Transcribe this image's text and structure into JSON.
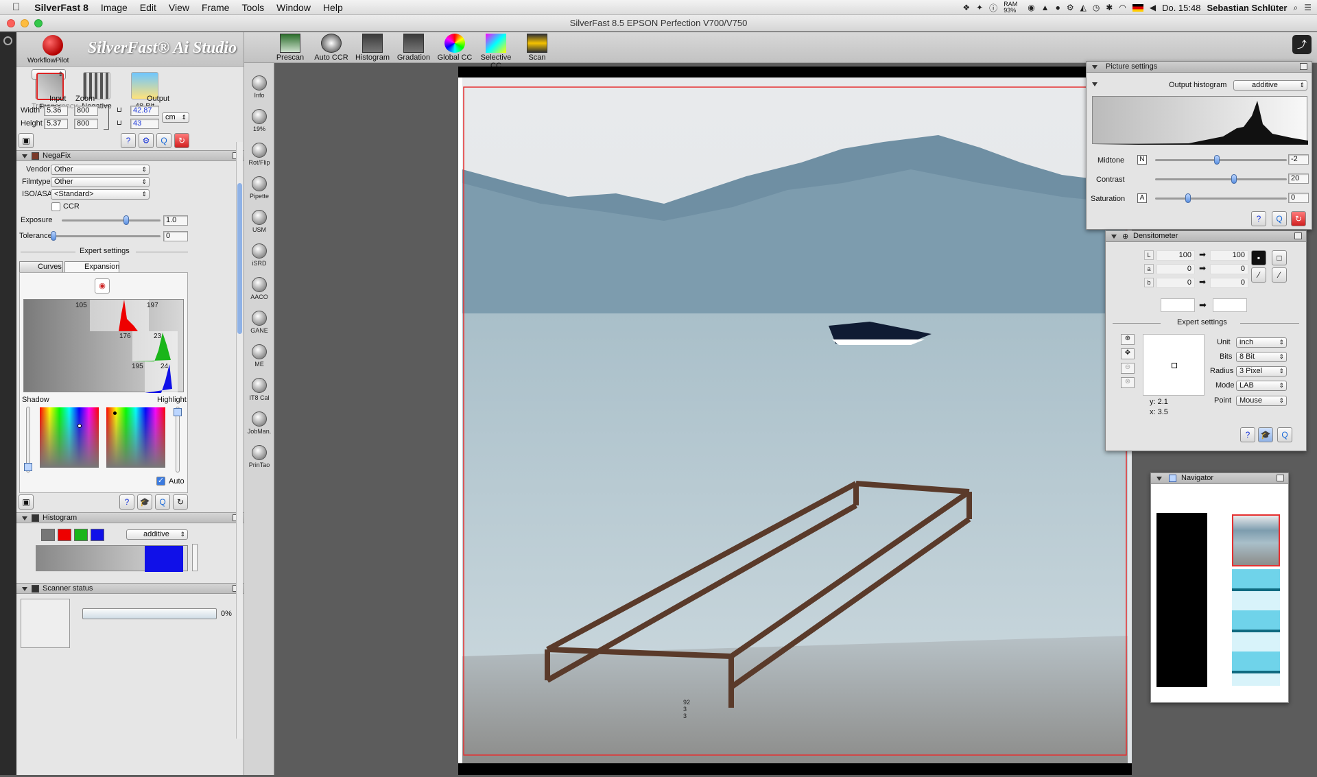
{
  "menubar": {
    "app": "SilverFast 8",
    "items": [
      "Image",
      "Edit",
      "View",
      "Frame",
      "Tools",
      "Window",
      "Help"
    ],
    "ram": "RAM 93%",
    "clock": "Do. 15:48",
    "user": "Sebastian Schlüter"
  },
  "window_title": "SilverFast 8.5 EPSON Perfection V700/V750",
  "logo": {
    "brand": "SilverFast® Ai Studio",
    "sub": "WorkflowPilot"
  },
  "modes": [
    {
      "label": "Transparency",
      "icon": "transparency-icon",
      "state": "dim"
    },
    {
      "label": "Negative",
      "icon": "negative-film-icon",
      "state": ""
    },
    {
      "label": "48 Bit",
      "icon": "48bit-palm-icon",
      "state": ""
    },
    {
      "label": "Frame",
      "icon": "frame-tools-icon",
      "state": "sel"
    }
  ],
  "dimensions": {
    "col_input": "Input",
    "col_zoom": "Zoom",
    "col_output": "Output",
    "width_label": "Width",
    "height_label": "Height",
    "width_in": "5.36",
    "width_zoom": "800",
    "width_out": "42.87",
    "height_in": "5.37",
    "height_zoom": "800",
    "height_out": "43",
    "unit": "cm"
  },
  "negafix": {
    "title": "NegaFix",
    "vendor_label": "Vendor",
    "vendor": "Other",
    "filmtype_label": "Filmtype",
    "filmtype": "Other",
    "iso_label": "ISO/ASA",
    "iso": "<Standard>",
    "ccr_label": "CCR",
    "exposure_label": "Exposure",
    "exposure": "1.0",
    "exposure_level": 0.65,
    "tolerance_label": "Tolerance",
    "tolerance": "0",
    "tolerance_level": 0.0,
    "expert": "Expert settings",
    "tab_curves": "Curves",
    "tab_expansion": "Expansion",
    "hist_red_left": "105",
    "hist_red_right": "197",
    "hist_green_left": "176",
    "hist_green_right": "23",
    "hist_blue_left": "195",
    "hist_blue_right": "24",
    "shadow": "Shadow",
    "highlight": "Highlight",
    "auto_label": "Auto"
  },
  "histogram": {
    "title": "Histogram",
    "mode": "additive"
  },
  "scanner_status": {
    "title": "Scanner status",
    "percent": "0%"
  },
  "toolbar": [
    {
      "label": "Prescan",
      "icon": "prescan-icon"
    },
    {
      "label": "Auto CCR",
      "icon": "auto-ccr-icon"
    },
    {
      "label": "Histogram",
      "icon": "histogram-icon"
    },
    {
      "label": "Gradation",
      "icon": "gradation-icon"
    },
    {
      "label": "Global CC",
      "icon": "global-cc-icon"
    },
    {
      "label": "Selective CC",
      "icon": "selective-cc-icon"
    },
    {
      "label": "Scan",
      "icon": "scan-icon"
    }
  ],
  "tools": [
    {
      "label": "Info",
      "icon": "info-icon"
    },
    {
      "label": "19%",
      "icon": "zoom-icon"
    },
    {
      "label": "Rot/Flip",
      "icon": "rotate-flip-icon"
    },
    {
      "label": "Pipette",
      "icon": "pipette-icon"
    },
    {
      "label": "USM",
      "icon": "usm-icon"
    },
    {
      "label": "iSRD",
      "icon": "isrd-icon"
    },
    {
      "label": "AACO",
      "icon": "aaco-icon"
    },
    {
      "label": "GANE",
      "icon": "gane-icon"
    },
    {
      "label": "ME",
      "icon": "me-icon"
    },
    {
      "label": "IT8 Cal",
      "icon": "it8-cal-icon"
    },
    {
      "label": "JobMan.",
      "icon": "job-manager-icon"
    },
    {
      "label": "PrinTao",
      "icon": "printao-icon"
    }
  ],
  "picture_settings": {
    "title": "Picture settings",
    "output_hist_label": "Output histogram",
    "output_hist_mode": "additive",
    "midtone_label": "Midtone",
    "midtone_btn": "N",
    "midtone": "-2",
    "midtone_level": 0.47,
    "contrast_label": "Contrast",
    "contrast": "20",
    "contrast_level": 0.6,
    "saturation_label": "Saturation",
    "saturation_btn": "A",
    "saturation": "0",
    "saturation_level": 0.25
  },
  "densitometer": {
    "title": "Densitometer",
    "rows": [
      {
        "ch": "L",
        "in": "100",
        "out": "100"
      },
      {
        "ch": "a",
        "in": "0",
        "out": "0"
      },
      {
        "ch": "b",
        "in": "0",
        "out": "0"
      }
    ],
    "expert": "Expert settings",
    "unit_label": "Unit",
    "unit": "inch",
    "bits_label": "Bits",
    "bits": "8 Bit",
    "radius_label": "Radius",
    "radius": "3 Pixel",
    "mode_label": "Mode",
    "mode": "LAB",
    "point_label": "Point",
    "point": "Mouse",
    "y": "y: 2.1",
    "x": "x: 3.5"
  },
  "navigator": {
    "title": "Navigator"
  },
  "overlay_readout": {
    "L": "92",
    "a": "3",
    "b": "3"
  },
  "colors": {
    "accent": "#1a35d8",
    "frame": "#e53030",
    "panel": "#e6e6e6"
  }
}
